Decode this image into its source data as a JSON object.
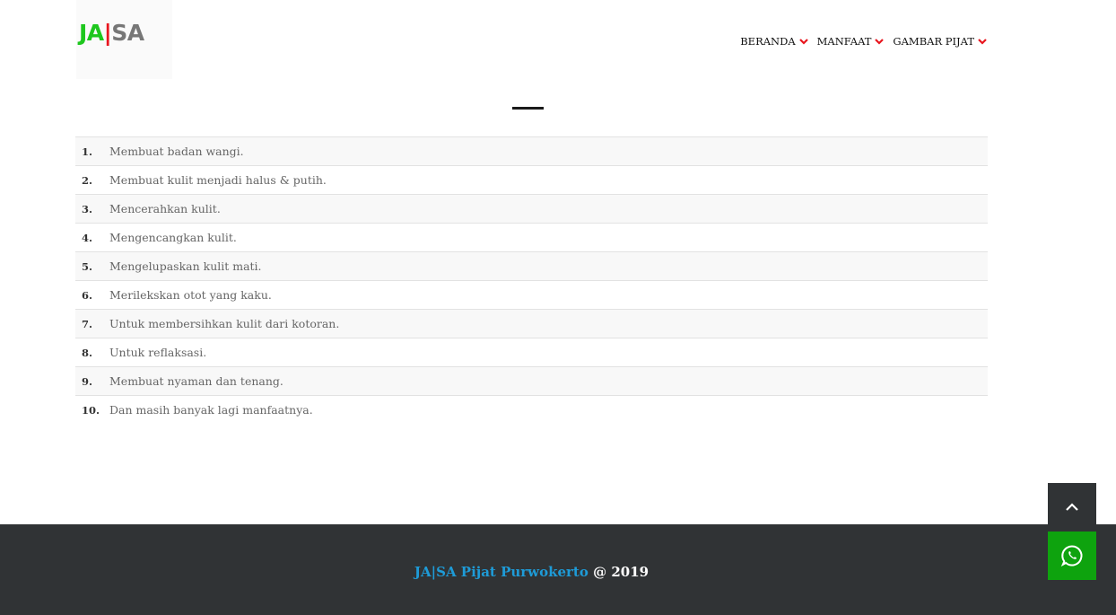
{
  "logo": {
    "part1": "JA",
    "part2": "|",
    "part3": "SA"
  },
  "nav": [
    {
      "label": "BERANDA"
    },
    {
      "label": "MANFAAT"
    },
    {
      "label": "GAMBAR PIJAT"
    }
  ],
  "benefits": [
    {
      "num": "1.",
      "text": "Membuat badan wangi."
    },
    {
      "num": "2.",
      "text": "Membuat kulit menjadi halus & putih."
    },
    {
      "num": "3.",
      "text": "Mencerahkan kulit."
    },
    {
      "num": "4.",
      "text": "Mengencangkan kulit."
    },
    {
      "num": "5.",
      "text": "Mengelupaskan kulit mati."
    },
    {
      "num": "6.",
      "text": "Merilekskan otot yang kaku."
    },
    {
      "num": "7.",
      "text": "Untuk membersihkan kulit dari kotoran."
    },
    {
      "num": "8.",
      "text": "Untuk reflaksasi."
    },
    {
      "num": "9.",
      "text": "Membuat nyaman dan tenang."
    },
    {
      "num": "10.",
      "text": "Dan masih banyak lagi manfaatnya."
    }
  ],
  "footer": {
    "brand": "JA|SA Pijat Purwokerto",
    "suffix": " @ 2019"
  },
  "colors": {
    "accent_red": "#e8161e",
    "logo_green": "#1ec71e",
    "footer_bg": "#303335",
    "footer_link": "#1e9bd7",
    "whatsapp_green": "#0ea30e"
  },
  "icons": {
    "nav_chevron": "chevron-down-icon",
    "scroll_top": "chevron-up-icon",
    "whatsapp": "whatsapp-icon"
  }
}
